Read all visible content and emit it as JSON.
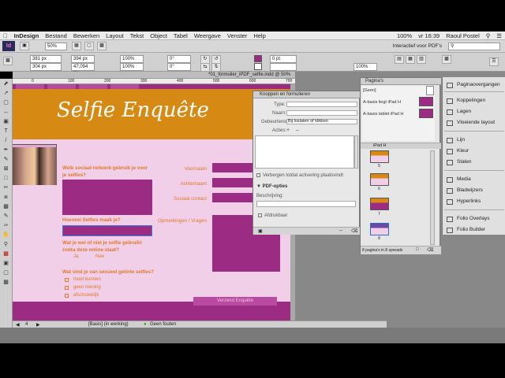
{
  "menubar": {
    "app": "InDesign",
    "items": [
      "Bestand",
      "Bewerken",
      "Layout",
      "Tekst",
      "Object",
      "Tabel",
      "Weergave",
      "Venster",
      "Help"
    ],
    "battery": "100%",
    "time": "vr 16:39",
    "user": "Raoul Postel"
  },
  "appbar": {
    "logo": "Id",
    "zoom": "50%",
    "workspace": "Interactief voor PDF's",
    "search_placeholder": ""
  },
  "control": {
    "x": "381 px",
    "y": "304 px",
    "w": "394 px",
    "h": "47,094 px",
    "scale1": "100%",
    "scale2": "100%",
    "angle": "0°",
    "stroke": "0 pt",
    "pct": "100%"
  },
  "document_tab": "*01_formulier_iPDF_selfie.indd @ 50%",
  "ruler_ticks": [
    "0",
    "100",
    "200",
    "300",
    "400",
    "500",
    "600",
    "700"
  ],
  "page": {
    "title": "Selfie Enquête",
    "q1": "Welk sociaal netwerk gebruik je voor je selfies?",
    "q2": "Hoeveel Selfies maak je?",
    "q3": "Wat je wel of niet je selfie gebruikt zodra deze online staat?",
    "q4": "Wat vind je van sexueel getinte selfies?",
    "labels": {
      "voornaam": "Voornaam",
      "achternaam": "Achternaam",
      "contact": "Sociaal contact",
      "opmerkingen": "Opmerkingen / Vragen"
    },
    "yes": "Ja",
    "no": "Nee",
    "options": [
      "moet kunnen",
      "geen mening",
      "afschuwelijk"
    ],
    "send": "Verzend Enquête"
  },
  "buttons_panel": {
    "title": "Knoppen en formulieren",
    "type_label": "Type:",
    "name_label": "Naam:",
    "event_label": "Gebeurtenis:",
    "event_value": "Bij loslaten of klikken",
    "actions_label": "Acties:",
    "hide_label": "Verbergen totdat activering plaatsvindt",
    "pdf_options": "PDF-opties",
    "desc_label": "Beschrijving:",
    "print_label": "Afdrukbaar"
  },
  "pages_panel": {
    "title": "Pagina's",
    "none": "[Geen]",
    "master_a": "A-basis liegt iPad H",
    "master_b": "A-basis tablet iPad H",
    "device": "iPad H",
    "page_numbers": [
      "5",
      "6",
      "7",
      "8"
    ],
    "footer": "8 pagina's in 8 spreads"
  },
  "dock": {
    "items": [
      "Paginaovergangen",
      "Koppelingen",
      "Lagen",
      "Vloeiende layout",
      "Lijn",
      "Kleur",
      "Stalen",
      "Media",
      "Bladwijzers",
      "Hyperlinks",
      "Folio Overlays",
      "Folio Builder"
    ]
  },
  "status": {
    "page": "4",
    "style": "[Basis] (in werking)",
    "errors": "Geen fouten"
  }
}
